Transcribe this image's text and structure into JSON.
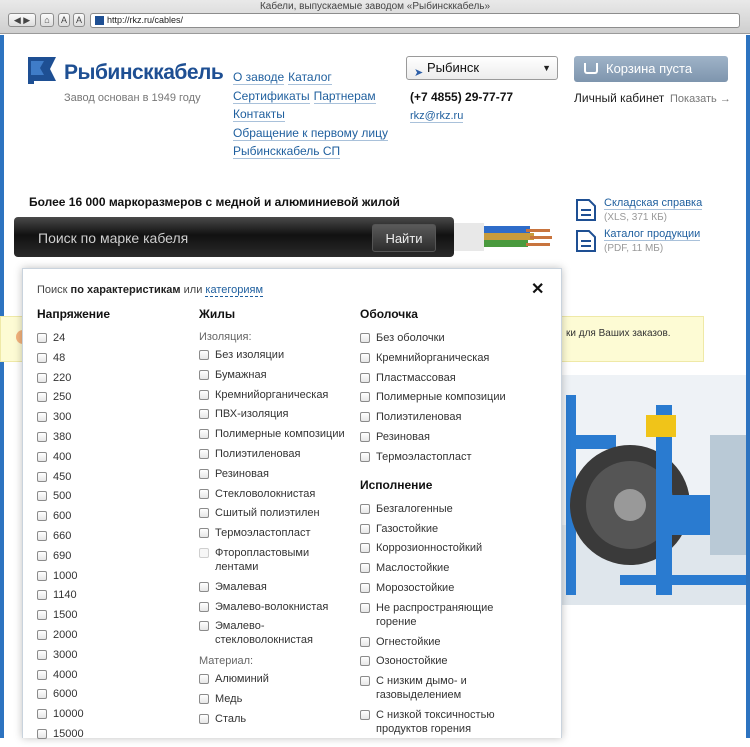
{
  "browser": {
    "title": "Кабели, выпускаемые заводом «Рыбинсккабель»",
    "url": "http://rkz.ru/cables/",
    "font_smaller": "A",
    "font_larger": "A"
  },
  "header": {
    "logo_text": "Рыбинсккабель",
    "tagline": "Завод основан в 1949 году",
    "nav": [
      "О заводе",
      "Каталог",
      "Сертификаты",
      "Партнерам",
      "Контакты",
      "Обращение к первому лицу",
      "Рыбинсккабель СП"
    ],
    "city": "Рыбинск",
    "phone": "(+7 4855) 29-77-77",
    "email": "rkz@rkz.ru",
    "cart": "Корзина пуста",
    "cabinet": "Личный кабинет",
    "show": "Показать →"
  },
  "search": {
    "headline": "Более 16 000 маркоразмеров с медной и алюминиевой жилой",
    "placeholder": "Поиск по марке кабеля",
    "button": "Найти"
  },
  "docs": [
    {
      "title": "Складская справка",
      "meta": "(XLS, 371 КБ)"
    },
    {
      "title": "Каталог продукции",
      "meta": "(PDF, 11 МБ)"
    }
  ],
  "notice": {
    "text": "ки для Ваших заказов."
  },
  "panel": {
    "head_prefix": "Поиск",
    "head_active": "по характеристикам",
    "head_mid": "или",
    "head_link": "категориям",
    "close": "✕",
    "voltage": {
      "title": "Напряжение",
      "items": [
        "24",
        "48",
        "220",
        "250",
        "300",
        "380",
        "400",
        "450",
        "500",
        "600",
        "660",
        "690",
        "1000",
        "1140",
        "1500",
        "2000",
        "3000",
        "4000",
        "6000",
        "10000",
        "15000"
      ]
    },
    "cores": {
      "title": "Жилы",
      "insulation_label": "Изоляция:",
      "insulation": [
        "Без изоляции",
        "Бумажная",
        "Кремнийорганическая",
        "ПВХ-изоляция",
        "Полимерные композиции",
        "Полиэтиленовая",
        "Резиновая",
        "Стекловолокнистая",
        "Сшитый полиэтилен",
        "Термоэластопласт",
        "Фторопластовыми лентами",
        "Эмалевая",
        "Эмалево-волокнистая",
        "Эмалево-стекловолокнистая"
      ],
      "material_label": "Материал:",
      "material": [
        "Алюминий",
        "Медь",
        "Сталь"
      ]
    },
    "sheath": {
      "title": "Оболочка",
      "items": [
        "Без оболочки",
        "Кремнийорганическая",
        "Пластмассовая",
        "Полимерные композиции",
        "Полиэтиленовая",
        "Резиновая",
        "Термоэластопласт"
      ]
    },
    "design": {
      "title": "Исполнение",
      "items": [
        "Безгалогенные",
        "Газостойкие",
        "Коррозионностойкий",
        "Маслостойкие",
        "Морозостойкие",
        "Не распространяющие горение",
        "Огнестойкие",
        "Озоностойкие",
        "С низким дымо- и газовыделением",
        "С низкой токсичностью продуктов горения"
      ]
    }
  }
}
